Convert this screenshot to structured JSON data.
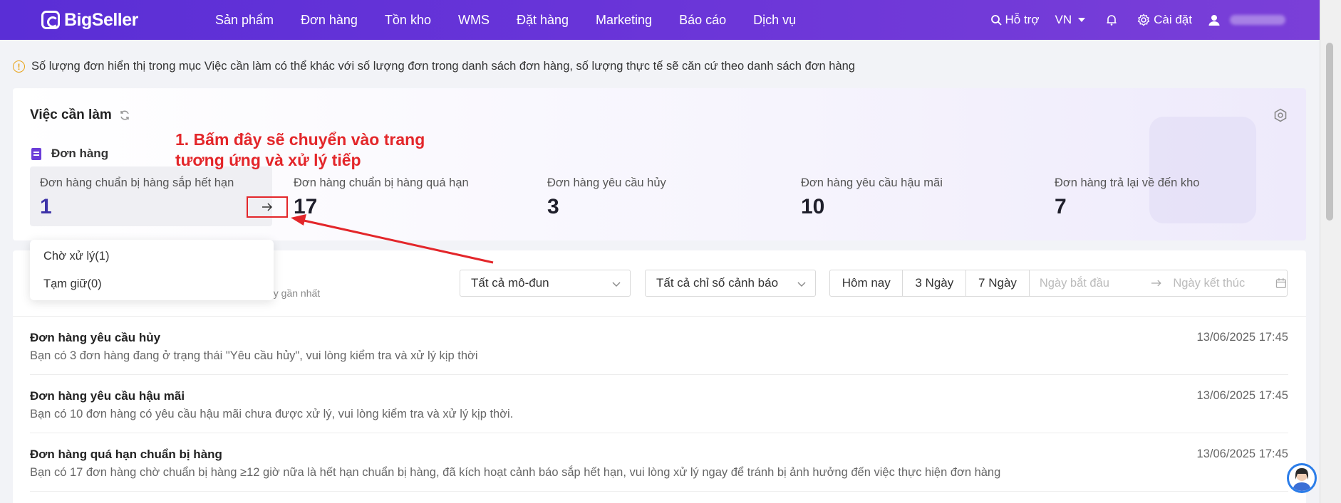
{
  "app": {
    "logo_text": "BigSeller"
  },
  "nav": {
    "items": [
      "Sản phẩm",
      "Đơn hàng",
      "Tồn kho",
      "WMS",
      "Đặt hàng",
      "Marketing",
      "Báo cáo",
      "Dịch vụ"
    ]
  },
  "topbar": {
    "help": "Hỗ trợ",
    "lang": "VN",
    "settings": "Cài đặt"
  },
  "notice": {
    "text": "Số lượng đơn hiển thị trong mục Việc cần làm có thể khác với số lượng đơn trong danh sách đơn hàng, số lượng thực tế sẽ căn cứ theo danh sách đơn hàng"
  },
  "todo": {
    "title": "Việc cần làm",
    "section_label": "Đơn hàng",
    "stats": [
      {
        "label": "Đơn hàng chuẩn bị hàng sắp hết hạn",
        "value": "1"
      },
      {
        "label": "Đơn hàng chuẩn bị hàng quá hạn",
        "value": "17"
      },
      {
        "label": "Đơn hàng yêu cầu hủy",
        "value": "3"
      },
      {
        "label": "Đơn hàng yêu cầu hậu mãi",
        "value": "10"
      },
      {
        "label": "Đơn hàng trả lại về đến kho",
        "value": "7"
      }
    ]
  },
  "annotation": {
    "line1": "1. Bấm đây sẽ chuyển vào trang",
    "line2": "tương ứng và xử lý tiếp"
  },
  "popover": {
    "items": [
      "Chờ xử lý(1)",
      "Tạm giữ(0)"
    ]
  },
  "filters": {
    "hint": "ày gần nhất",
    "module_select": "Tất cả mô-đun",
    "alert_select": "Tất cả chỉ số cảnh báo",
    "ranges": [
      "Hôm nay",
      "3 Ngày",
      "7 Ngày"
    ],
    "start_placeholder": "Ngày bắt đầu",
    "end_placeholder": "Ngày kết thúc"
  },
  "rows": [
    {
      "title": "Đơn hàng yêu cầu hủy",
      "desc": "Bạn có 3 đơn hàng đang ở trạng thái \"Yêu cầu hủy\", vui lòng kiểm tra và xử lý kịp thời",
      "time": "13/06/2025 17:45"
    },
    {
      "title": "Đơn hàng yêu cầu hậu mãi",
      "desc": "Bạn có 10 đơn hàng có yêu cầu hậu mãi chưa được xử lý, vui lòng kiểm tra và xử lý kịp thời.",
      "time": "13/06/2025 17:45"
    },
    {
      "title": "Đơn hàng quá hạn chuẩn bị hàng",
      "desc": "Bạn có 17 đơn hàng chờ chuẩn bị hàng ≥12 giờ nữa là hết hạn chuẩn bị hàng, đã kích hoạt cảnh báo sắp hết hạn, vui lòng xử lý ngay để tránh bị ảnh hưởng đến việc thực hiện đơn hàng",
      "time": "13/06/2025 17:45"
    }
  ],
  "colors": {
    "brand": "#5a2ed6",
    "annotation": "#e3262a",
    "active_value": "#3d33a8"
  },
  "icons": [
    "search-icon",
    "bell-icon",
    "gear-icon",
    "user-icon",
    "refresh-icon",
    "warning-icon",
    "arrow-right-icon",
    "calendar-icon",
    "chevron-down-icon"
  ]
}
